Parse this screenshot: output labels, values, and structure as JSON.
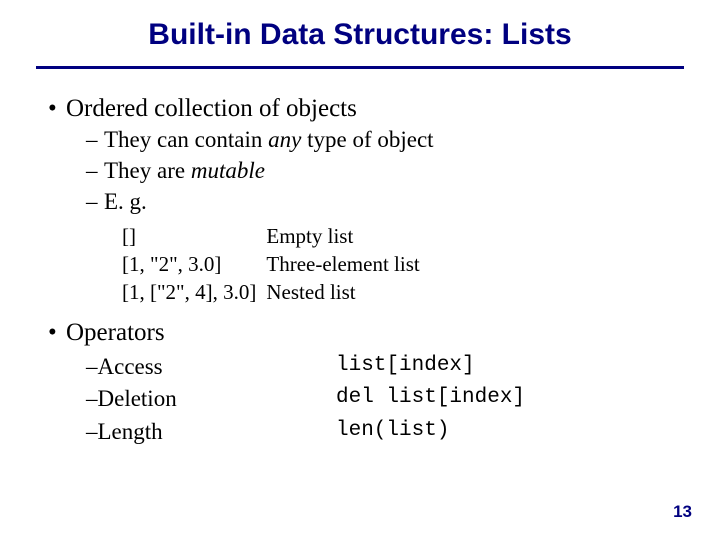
{
  "title": "Built-in Data Structures: Lists",
  "bullets": {
    "ordered": "Ordered collection of objects",
    "operators": "Operators"
  },
  "subs": {
    "contain_pre": "They can contain ",
    "contain_em": "any",
    "contain_post": " type of object",
    "mutable_pre": "They are ",
    "mutable_em": "mutable",
    "eg": "E. g."
  },
  "examples": [
    {
      "code": "[]",
      "desc": "Empty list"
    },
    {
      "code": "[1, \"2\", 3.0]",
      "desc": "Three-element list"
    },
    {
      "code": "[1, [\"2\", 4], 3.0]",
      "desc": "Nested list"
    }
  ],
  "ops": [
    {
      "label": "Access",
      "code": "list[index]"
    },
    {
      "label": "Deletion",
      "code": "del list[index]"
    },
    {
      "label": "Length",
      "code": "len(list)"
    }
  ],
  "pagenum": "13"
}
